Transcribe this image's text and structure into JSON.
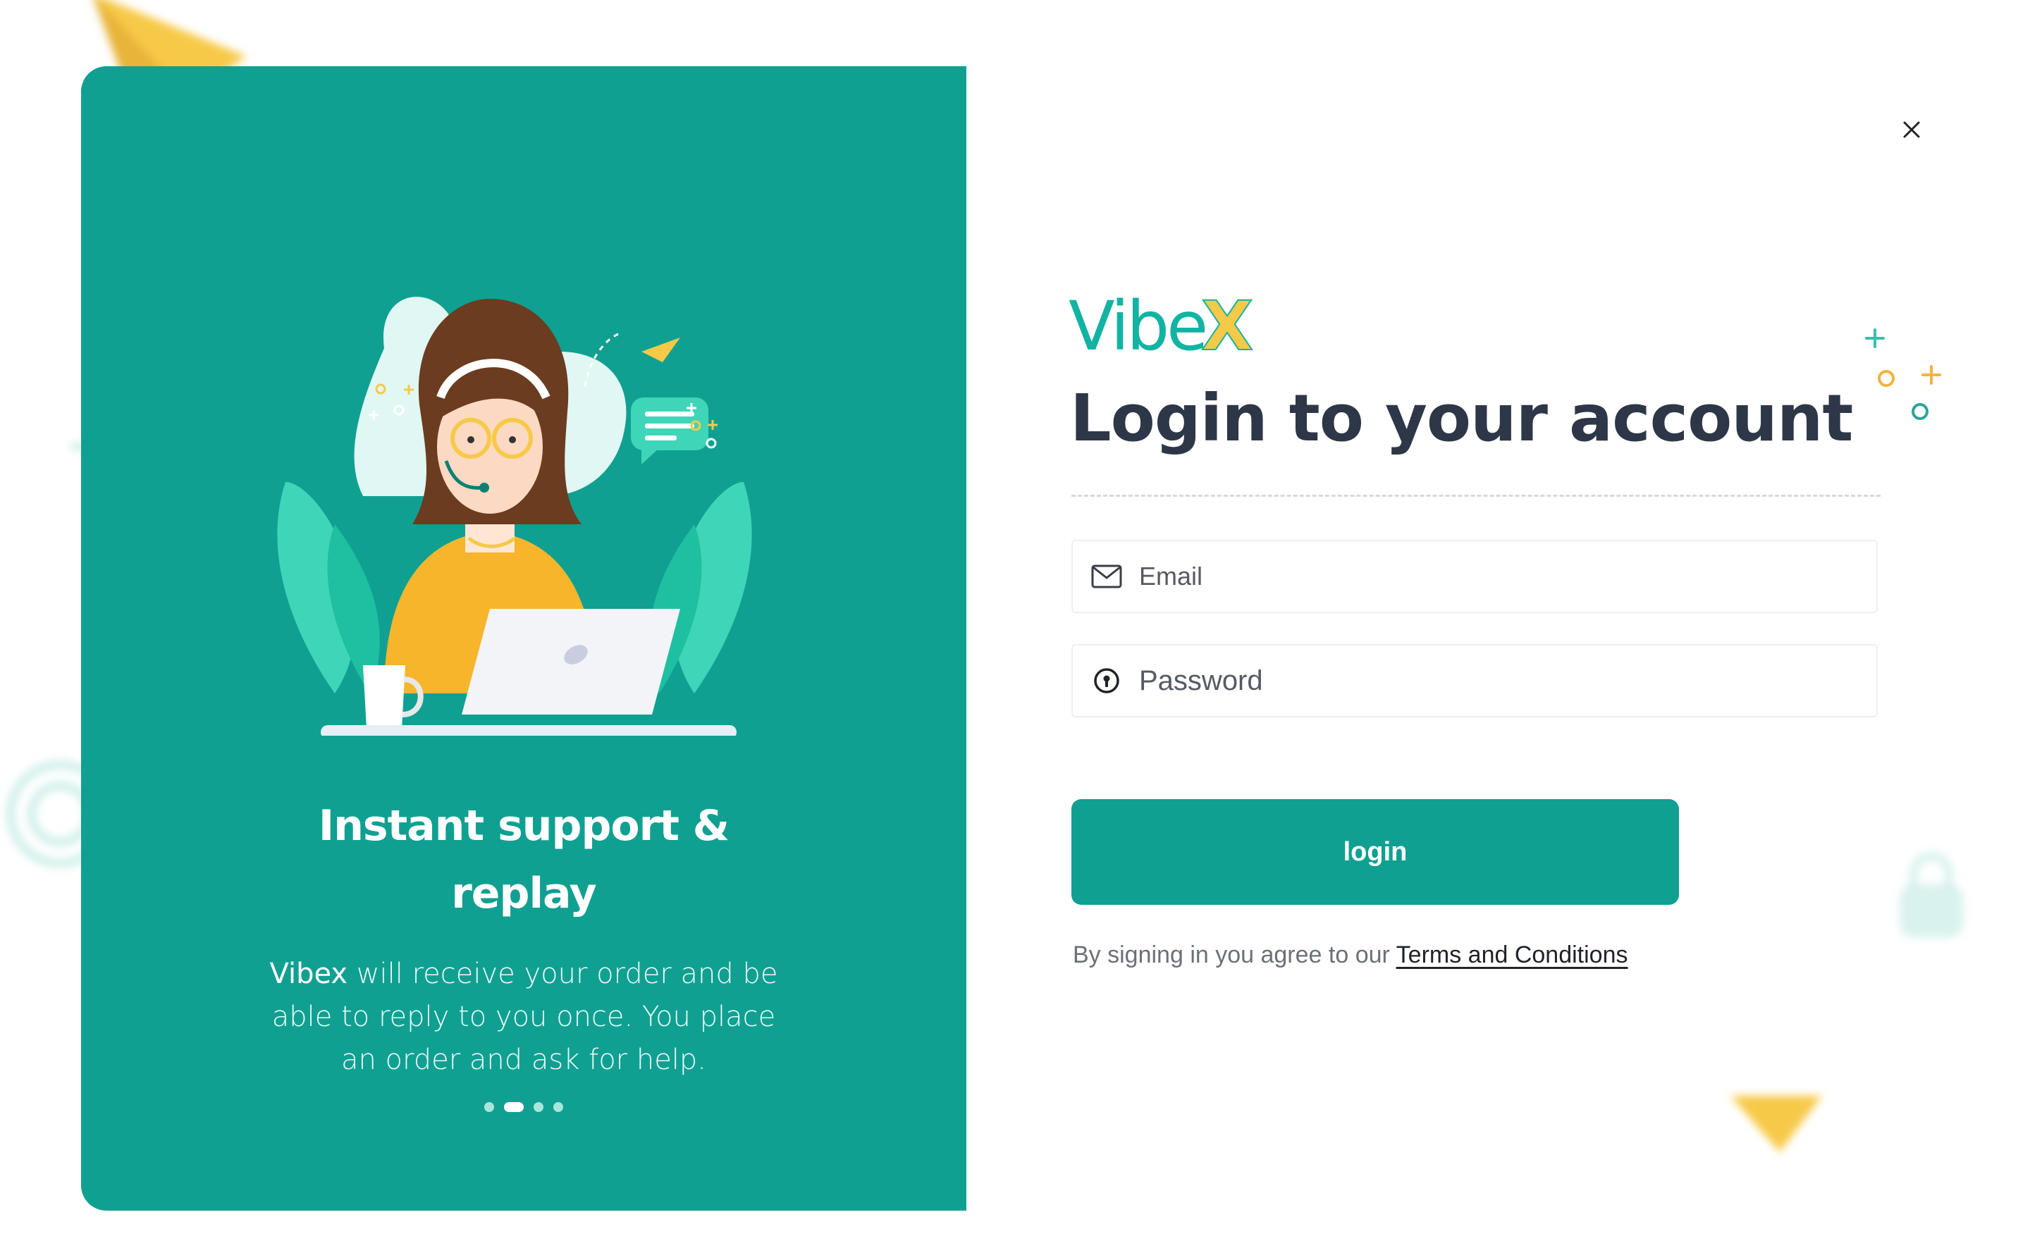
{
  "colors": {
    "accent": "#10a091",
    "brand_teal": "#12b3a3",
    "brand_yellow": "#f7c948",
    "title": "#2d3748"
  },
  "slide": {
    "title_line1": "Instant support &",
    "title_line2": "replay",
    "desc_brand": "Vibex",
    "desc_rest": " will receive your order and be able to reply to you once. You place an order and ask for help.",
    "dots_total": 4,
    "dots_active": 2
  },
  "logo": {
    "text_main": "Vibe",
    "text_accent": "X"
  },
  "login": {
    "title": "Login to your account",
    "email_placeholder": "Email",
    "password_placeholder": "Password",
    "button_label": "login",
    "terms_prefix": "By signing in you agree to our ",
    "terms_link": "Terms and Conditions"
  },
  "icons": {
    "close": "close-icon",
    "email": "mail-icon",
    "password": "lock-icon"
  }
}
